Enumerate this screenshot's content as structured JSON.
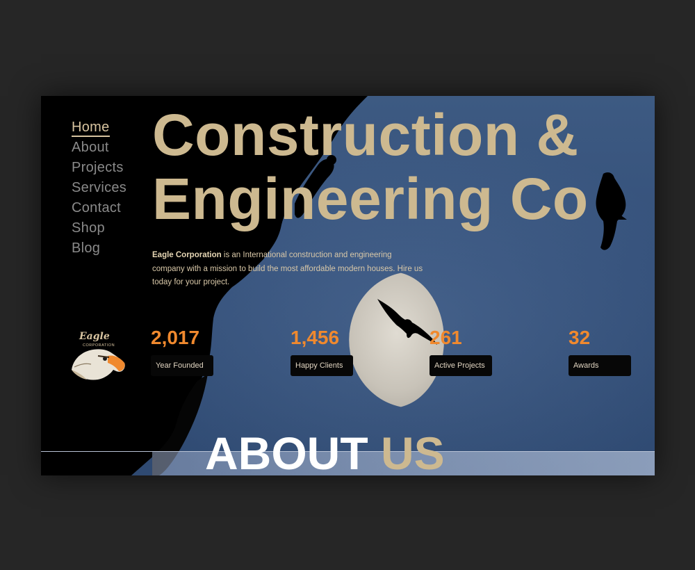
{
  "nav": {
    "items": [
      {
        "label": "Home",
        "active": true
      },
      {
        "label": "About",
        "active": false
      },
      {
        "label": "Projects",
        "active": false
      },
      {
        "label": "Services",
        "active": false
      },
      {
        "label": "Contact",
        "active": false
      },
      {
        "label": "Shop",
        "active": false
      },
      {
        "label": "Blog",
        "active": false
      }
    ]
  },
  "hero": {
    "title_line1": "Construction &",
    "title_line2": "Engineering Co",
    "company": "Eagle Corporation",
    "description": " is an International construction and engineering company with a mission to build the most affordable modern houses. Hire us today for your project."
  },
  "logo": {
    "name": "Eagle",
    "subtitle": "CORPORATION",
    "icon": "eagle-head-icon"
  },
  "stats": [
    {
      "value": "2,017",
      "label": "Year Founded"
    },
    {
      "value": "1,456",
      "label": "Happy Clients"
    },
    {
      "value": "261",
      "label": "Active Projects"
    },
    {
      "value": "32",
      "label": "Awards"
    }
  ],
  "about": {
    "word1": "ABOUT",
    "word2": "US"
  },
  "colors": {
    "accent_gold": "#cdb990",
    "accent_orange": "#f0892e",
    "background_dark": "#000000",
    "sky_blue": "#3d5a82"
  }
}
